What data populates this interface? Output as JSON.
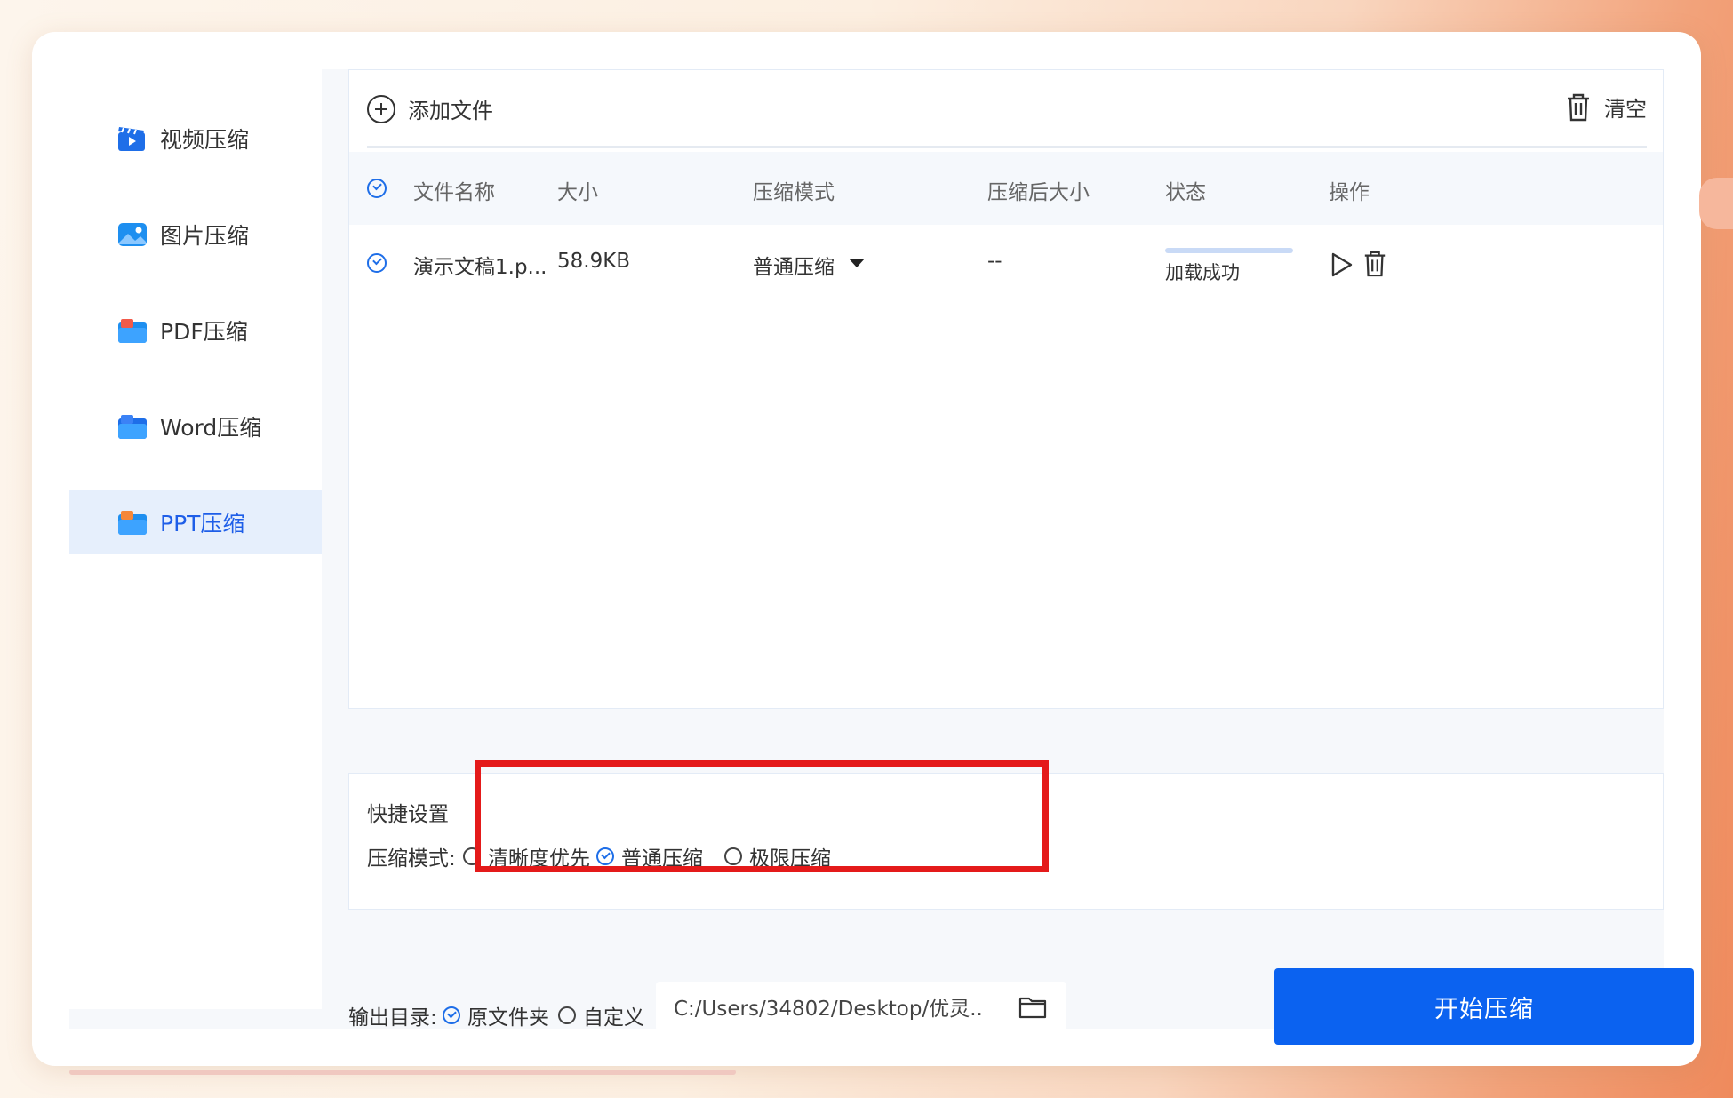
{
  "sidebar": {
    "items": [
      {
        "label": "视频压缩",
        "icon": "video-clapper-icon",
        "active": false
      },
      {
        "label": "图片压缩",
        "icon": "image-icon",
        "active": false
      },
      {
        "label": "PDF压缩",
        "icon": "pdf-folder-icon",
        "active": false
      },
      {
        "label": "Word压缩",
        "icon": "word-folder-icon",
        "active": false
      },
      {
        "label": "PPT压缩",
        "icon": "ppt-folder-icon",
        "active": true
      }
    ]
  },
  "toolbar": {
    "add_label": "添加文件",
    "clear_label": "清空"
  },
  "table": {
    "headers": {
      "name": "文件名称",
      "size": "大小",
      "mode": "压缩模式",
      "compressed_size": "压缩后大小",
      "status": "状态",
      "actions": "操作"
    },
    "rows": [
      {
        "name": "演示文稿1.p...",
        "size": "58.9KB",
        "mode": "普通压缩",
        "compressed_size": "--",
        "status": "加载成功",
        "progress": 1.0
      }
    ]
  },
  "quick": {
    "title": "快捷设置",
    "mode_label": "压缩模式:",
    "options": [
      {
        "label": "清晰度优先",
        "selected": false
      },
      {
        "label": "普通压缩",
        "selected": true
      },
      {
        "label": "极限压缩",
        "selected": false
      }
    ]
  },
  "output": {
    "label": "输出目录:",
    "options": [
      {
        "label": "原文件夹",
        "selected": true
      },
      {
        "label": "自定义",
        "selected": false
      }
    ],
    "path": "C:/Users/34802/Desktop/优灵.."
  },
  "start_label": "开始压缩",
  "colors": {
    "accent": "#0b62f0",
    "active_bg": "#e6effc",
    "highlight": "#e41a1a"
  }
}
